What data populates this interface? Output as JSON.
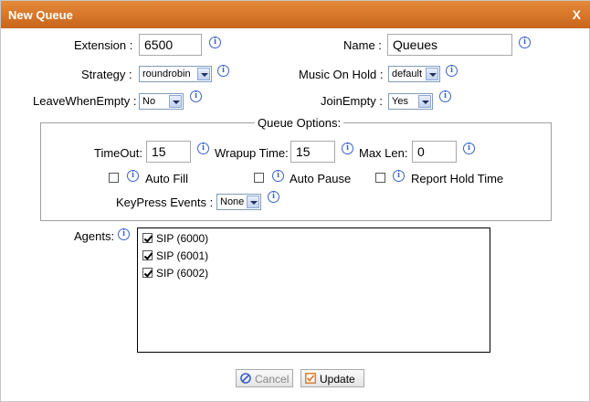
{
  "window": {
    "title": "New Queue",
    "close_label": "X"
  },
  "fields": {
    "extension_label": "Extension :",
    "extension_value": "6500",
    "name_label": "Name :",
    "name_value": "Queues",
    "strategy_label": "Strategy :",
    "strategy_value": "roundrobin",
    "music_label": "Music On Hold :",
    "music_value": "default",
    "leave_label": "LeaveWhenEmpty :",
    "leave_value": "No",
    "join_label": "JoinEmpty :",
    "join_value": "Yes"
  },
  "queue_options": {
    "legend": "Queue Options:",
    "timeout_label": "TimeOut:",
    "timeout_value": "15",
    "wrapup_label": "Wrapup Time:",
    "wrapup_value": "15",
    "maxlen_label": "Max Len:",
    "maxlen_value": "0",
    "autofill_label": "Auto Fill",
    "autofill_checked": false,
    "autopause_label": "Auto Pause",
    "autopause_checked": false,
    "reportholdtime_label": "Report Hold Time",
    "reportholdtime_checked": false,
    "keypress_label": "KeyPress Events :",
    "keypress_value": "None"
  },
  "agents": {
    "label": "Agents:",
    "items": [
      {
        "label": "SIP (6000)",
        "checked": true
      },
      {
        "label": "SIP (6001)",
        "checked": true
      },
      {
        "label": "SIP (6002)",
        "checked": true
      }
    ]
  },
  "buttons": {
    "cancel_label": "Cancel",
    "update_label": "Update"
  },
  "icons": {
    "info": "info-icon",
    "cancel": "cancel-icon",
    "update": "update-icon"
  },
  "colors": {
    "titlebar": "#d9762a",
    "info": "#3a62c8"
  }
}
